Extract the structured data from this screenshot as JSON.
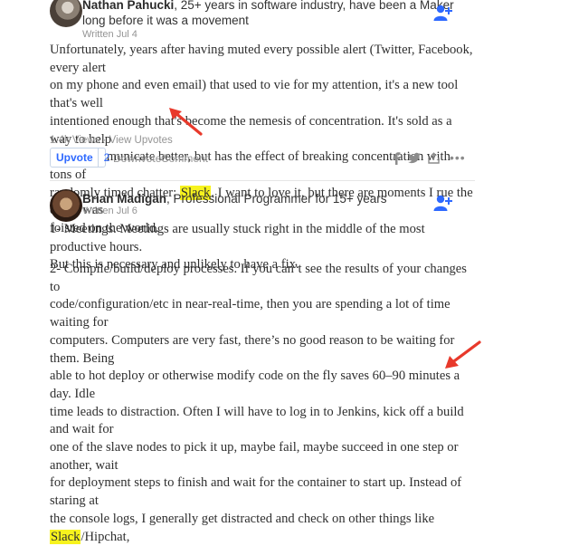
{
  "answer1": {
    "author": "Nathan Pahucki",
    "credential": ", 25+ years in software industry, have been a Maker",
    "credential_cont": "long before it was a movement",
    "written": "Written Jul 4",
    "body_lines": [
      "Unfortunately, years after having muted every possible alert (Twitter, Facebook, every alert",
      "on my phone and even email) that used to vie for my attention, it's a new tool that's well",
      "intentioned enough that's become the nemesis of concentration. It's sold as a way to help",
      "teams communicate better, but has the effect of breaking concentration with tons of"
    ],
    "line5_pre": "randomly timed chatter: ",
    "highlight": "Slack",
    "line5_post": ". I want to love it, but there are moments I rue the day it was",
    "line6": "foisted on the world.",
    "views": "1.4k Views · View Upvotes",
    "upvote_label": "Upvote",
    "upvote_count": "2",
    "downvote_label": "Downvote",
    "comment_label": "Comment"
  },
  "answer2": {
    "author": "Brian Madigan",
    "credential": ", Professional Programmer for 15+ years",
    "written": "Written Jul 6",
    "p1_lines": [
      "1- Meetings. Meetings are usually stuck right in the middle of the most productive hours.",
      "But this is necessary and unlikely to have a fix."
    ],
    "p2_lines": [
      "2- Compile/build/deploy processes. If you can’t see the results of your changes to",
      "code/configuration/etc in near-real-time, then you are spending a lot of time waiting for",
      "computers. Computers are very fast, there’s no good reason to be waiting for them. Being",
      "able to hot deploy or otherwise modify code on the fly saves 60–90 minutes a day. Idle",
      "time leads to distraction. Often I will have to log in to Jenkins, kick off a build and wait for",
      "one of the slave nodes to pick it up, maybe fail, maybe succeed in one step or another, wait",
      "for deployment steps to finish and wait for the container to start up. Instead of staring at"
    ],
    "last_pre": "the console logs, I generally get distracted and check on other things like ",
    "highlight": "Slack",
    "last_post": "/Hipchat,"
  },
  "colors": {
    "highlight": "#f7f31e",
    "arrow": "#e8392b",
    "link_blue": "#2e69ff"
  }
}
